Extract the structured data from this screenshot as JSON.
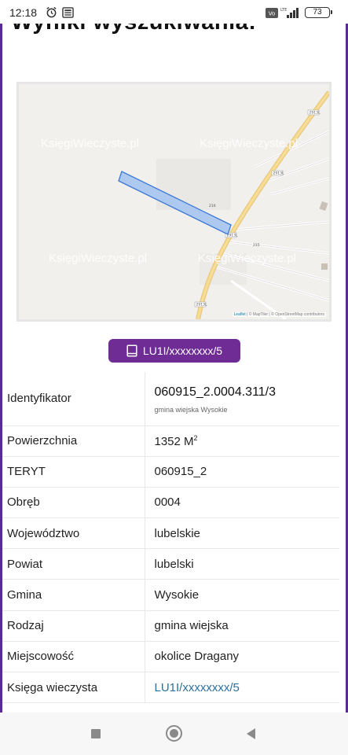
{
  "status_bar": {
    "time": "12:18",
    "battery": "73",
    "icons": [
      "alarm-icon",
      "news-icon",
      "volte-icon",
      "signal-icon",
      "battery-icon"
    ],
    "network_label": "LTE"
  },
  "page": {
    "title": "Wyniki wyszukiwania:",
    "accent_color": "#6e2c94"
  },
  "map": {
    "watermarks": [
      "KsięgiWieczyste.pl",
      "KsięgiWieczyste.pl",
      "KsięgiWieczyste.pl",
      "KsięgiWieczyste.pl"
    ],
    "road_labels": [
      "2913L",
      "2913L",
      "2913L",
      "2913L"
    ],
    "plot_labels": [
      "216",
      "215"
    ],
    "attribution": {
      "leaflet": "Leaflet",
      "rest": " | © MapTiler | © OpenStreetMap contributors"
    }
  },
  "kw_button": {
    "label": "LU1I/xxxxxxxx/5",
    "icon": "book-icon"
  },
  "details": {
    "identyfikator_label": "Identyfikator",
    "identyfikator_value": "060915_2.0004.311/3",
    "identyfikator_sub": "gmina wiejska Wysokie",
    "powierzchnia_label": "Powierzchnia",
    "powierzchnia_value": "1352 M",
    "powierzchnia_exp": "2",
    "teryt_label": "TERYT",
    "teryt_value": "060915_2",
    "obreb_label": "Obręb",
    "obreb_value": "0004",
    "wojewodztwo_label": "Województwo",
    "wojewodztwo_value": "lubelskie",
    "powiat_label": "Powiat",
    "powiat_value": "lubelski",
    "gmina_label": "Gmina",
    "gmina_value": "Wysokie",
    "rodzaj_label": "Rodzaj",
    "rodzaj_value": "gmina wiejska",
    "miejscowosc_label": "Miejscowość",
    "miejscowosc_value": "okolice Dragany",
    "ksiega_label": "Księga wieczysta",
    "ksiega_value": "LU1I/xxxxxxxx/5"
  },
  "nav_bar": {
    "icons": [
      "recent-apps-icon",
      "home-icon",
      "back-icon"
    ]
  }
}
